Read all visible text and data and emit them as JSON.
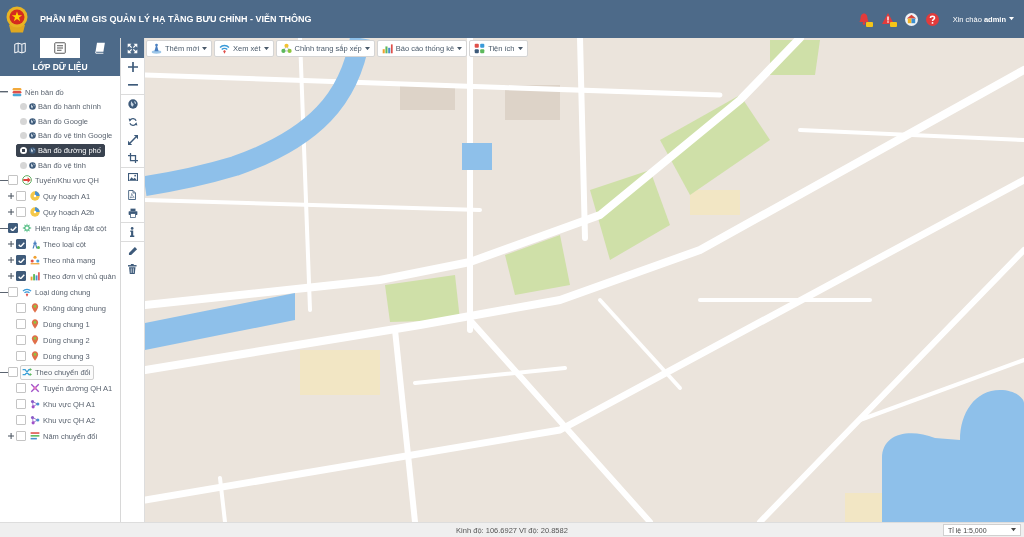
{
  "header": {
    "title": "PHẦN MỀM GIS QUẢN LÝ HẠ TẦNG BƯU CHÍNH - VIỄN THÔNG",
    "greeting": "Xin chào **admin**"
  },
  "sidebar": {
    "tabs": [
      {
        "selected": false
      },
      {
        "selected": true
      },
      {
        "selected": false
      }
    ],
    "heading": "LỚP DỮ LIỆU",
    "layers": [
      {
        "label": "Nền bản đồ",
        "kind": "group",
        "selected": false,
        "expanded": true,
        "children": [
          {
            "label": "Bản đồ hành chính",
            "kind": "radio",
            "selected": false
          },
          {
            "label": "Bản đồ Google",
            "kind": "radio",
            "selected": false
          },
          {
            "label": "Bản đồ vệ tinh Google",
            "kind": "radio",
            "selected": false
          },
          {
            "label": "Bản đồ đường phố",
            "kind": "radio",
            "selected": true
          },
          {
            "label": "Bản đồ vệ tinh",
            "kind": "radio",
            "selected": false
          }
        ]
      },
      {
        "label": "Tuyến/Khu vực QH",
        "kind": "checkbox",
        "checked": false,
        "selected": false,
        "expanded": true,
        "children": [
          {
            "label": "Quy hoạch A1",
            "kind": "checkbox",
            "checked": false,
            "selected": false,
            "expanded": false
          },
          {
            "label": "Quy hoạch A2b",
            "kind": "checkbox",
            "checked": false,
            "selected": false,
            "expanded": false
          }
        ]
      },
      {
        "label": "Hiện trạng lắp đặt cột",
        "kind": "checkbox",
        "checked": true,
        "selected": false,
        "expanded": true,
        "children": [
          {
            "label": "Theo loại cột",
            "kind": "checkbox",
            "checked": true,
            "selected": false,
            "expanded": false
          },
          {
            "label": "Theo nhà mạng",
            "kind": "checkbox",
            "checked": true,
            "selected": false,
            "expanded": false
          },
          {
            "label": "Theo đơn vị chủ quản",
            "kind": "checkbox",
            "checked": true,
            "selected": false,
            "expanded": false
          }
        ]
      },
      {
        "label": "Loại dùng chung",
        "kind": "checkbox",
        "checked": false,
        "selected": false,
        "expanded": true,
        "children": [
          {
            "label": "Không dùng chung",
            "kind": "checkbox",
            "checked": false,
            "selected": false
          },
          {
            "label": "Dùng chung 1",
            "kind": "checkbox",
            "checked": false,
            "selected": false
          },
          {
            "label": "Dùng chung 2",
            "kind": "checkbox",
            "checked": false,
            "selected": false
          },
          {
            "label": "Dùng chung 3",
            "kind": "checkbox",
            "checked": false,
            "selected": false
          }
        ]
      },
      {
        "label": "Theo chuyển đổi",
        "kind": "checkbox",
        "checked": false,
        "selected": true,
        "expanded": true,
        "children": [
          {
            "label": "Tuyến đường QH A1",
            "kind": "checkbox",
            "checked": false,
            "selected": false
          },
          {
            "label": "Khu vực QH A1",
            "kind": "checkbox",
            "checked": false,
            "selected": false
          },
          {
            "label": "Khu vực QH A2",
            "kind": "checkbox",
            "checked": false,
            "selected": false
          },
          {
            "label": "Năm chuyển đổi",
            "kind": "checkbox",
            "checked": false,
            "selected": false,
            "expanded": false
          }
        ]
      }
    ]
  },
  "map_toolbar": {
    "menus": [
      "Thêm mới",
      "Xem xét",
      "Chỉnh trang sắp xếp",
      "Báo cáo thống kê",
      "Tiện ích"
    ]
  },
  "status_bar": {
    "coordinates": "Kinh độ: 106.6927 Vĩ độ: 20.8582",
    "scale": "Tỉ lệ 1:5,000"
  }
}
